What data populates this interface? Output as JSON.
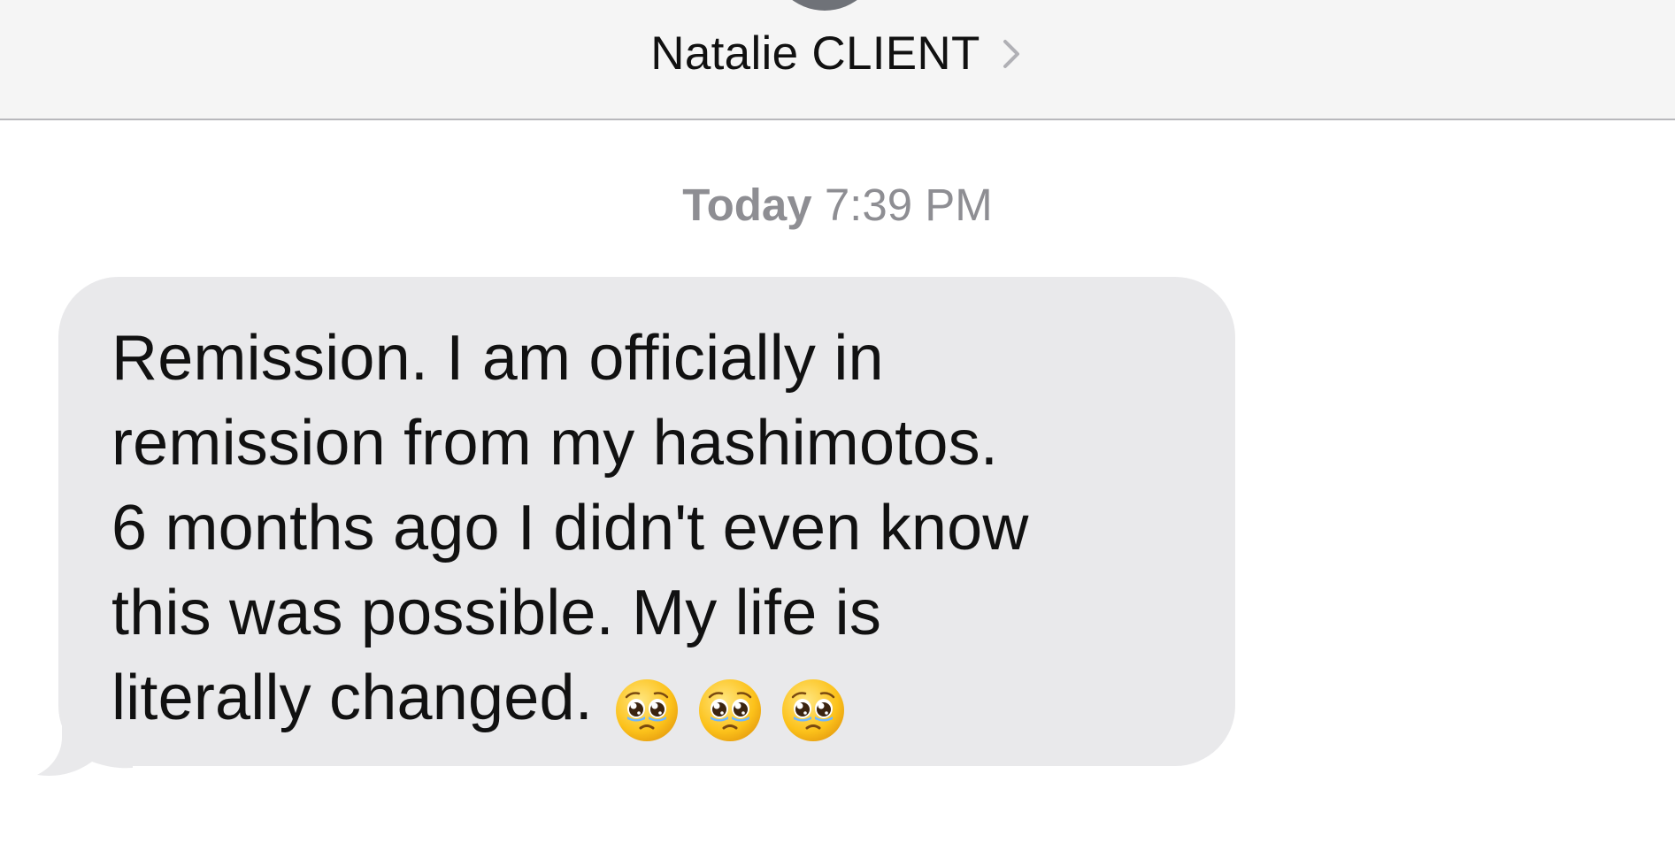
{
  "header": {
    "contact_name": "Natalie CLIENT"
  },
  "thread": {
    "timestamp_day": "Today",
    "timestamp_time": "7:39 PM"
  },
  "message": {
    "text": "Remission. I am officially in\nremission from my hashimotos.\n6 months ago I didn't even know\nthis was possible. My life is\nliterally changed.",
    "emojis": [
      "pleading-face-icon",
      "pleading-face-icon",
      "pleading-face-icon"
    ]
  },
  "colors": {
    "header_bg": "#f5f5f5",
    "bubble_bg": "#e9e9eb",
    "timestamp": "#8e8e93",
    "avatar": "#6f7278"
  }
}
